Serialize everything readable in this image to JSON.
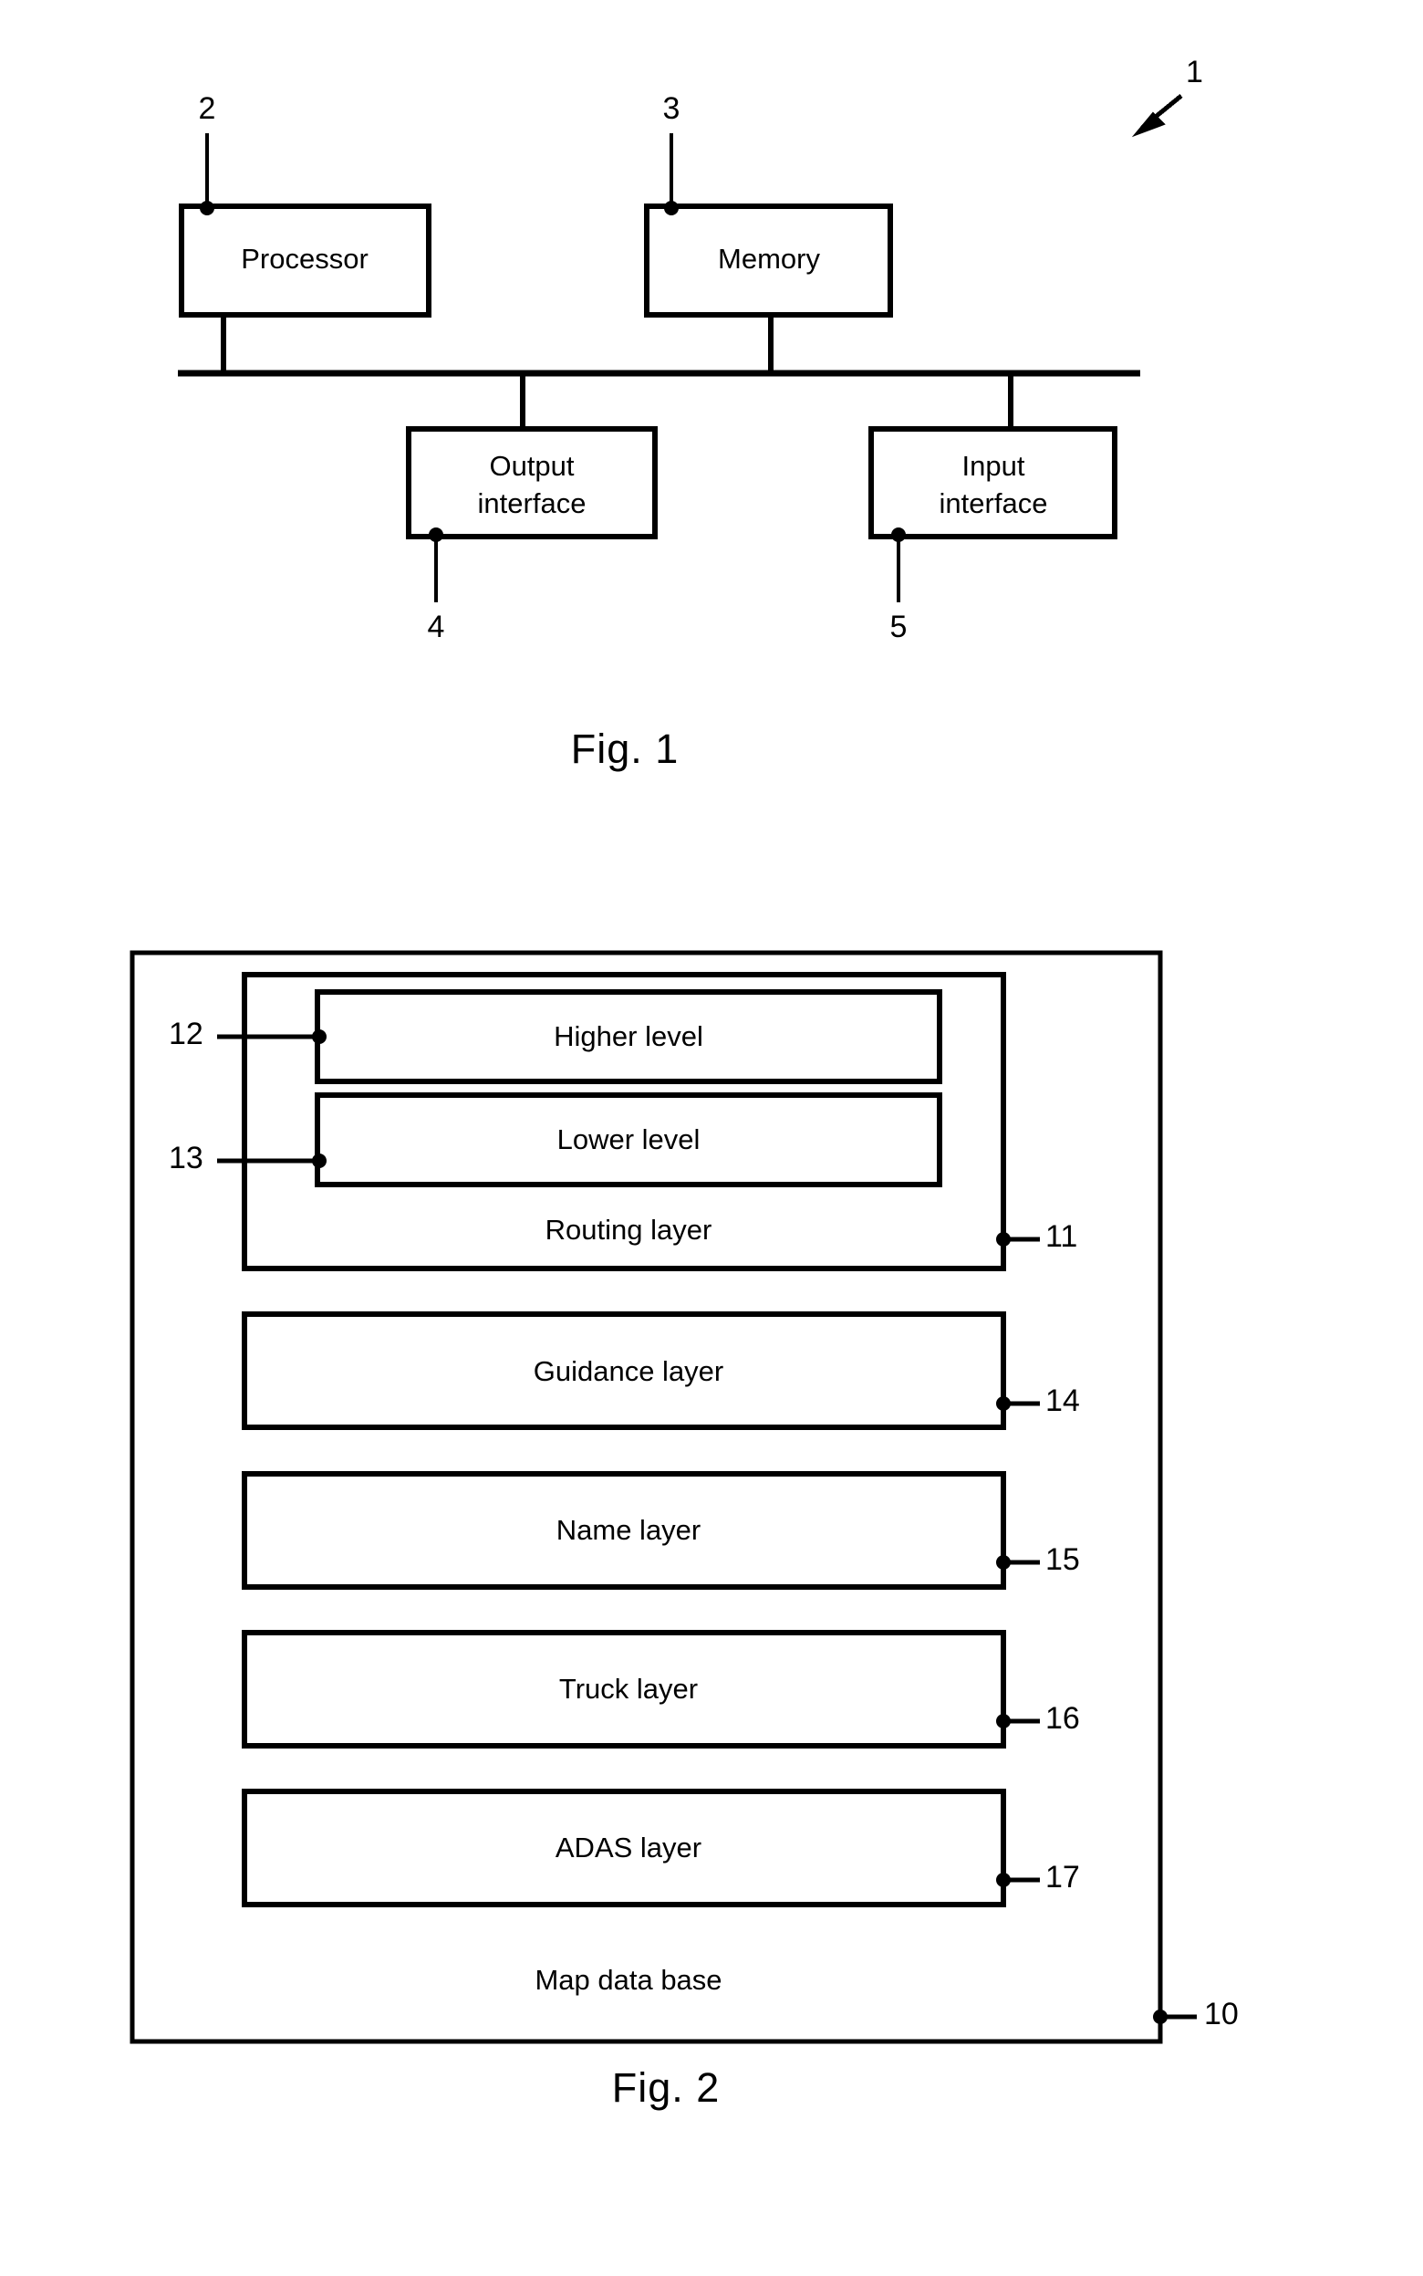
{
  "document": {
    "kind": "patent-drawing-sheet",
    "figures": [
      {
        "caption": "Fig. 1",
        "assembly_ref": "1",
        "blocks": [
          {
            "label": "Processor",
            "ref": "2"
          },
          {
            "label": "Memory",
            "ref": "3"
          },
          {
            "label": "Output\ninterface",
            "ref": "4"
          },
          {
            "label": "Input\ninterface",
            "ref": "5"
          }
        ]
      },
      {
        "caption": "Fig. 2",
        "container": {
          "label": "Map data base",
          "ref": "10"
        },
        "blocks": [
          {
            "label": "Routing layer",
            "ref": "11"
          },
          {
            "label": "Higher level",
            "ref": "12"
          },
          {
            "label": "Lower level",
            "ref": "13"
          },
          {
            "label": "Guidance layer",
            "ref": "14"
          },
          {
            "label": "Name layer",
            "ref": "15"
          },
          {
            "label": "Truck layer",
            "ref": "16"
          },
          {
            "label": "ADAS layer",
            "ref": "17"
          }
        ]
      }
    ]
  },
  "fig1": {
    "caption": "Fig. 1",
    "ref_assembly": "1",
    "processor": {
      "label": "Processor",
      "ref": "2"
    },
    "memory": {
      "label": "Memory",
      "ref": "3"
    },
    "output_interface": {
      "label_line1": "Output",
      "label_line2": "interface",
      "ref": "4"
    },
    "input_interface": {
      "label_line1": "Input",
      "label_line2": "interface",
      "ref": "5"
    }
  },
  "fig2": {
    "caption": "Fig. 2",
    "database": {
      "label": "Map data base",
      "ref": "10"
    },
    "routing_layer": {
      "label": "Routing layer",
      "ref": "11"
    },
    "higher_level": {
      "label": "Higher level",
      "ref": "12"
    },
    "lower_level": {
      "label": "Lower level",
      "ref": "13"
    },
    "guidance_layer": {
      "label": "Guidance layer",
      "ref": "14"
    },
    "name_layer": {
      "label": "Name layer",
      "ref": "15"
    },
    "truck_layer": {
      "label": "Truck layer",
      "ref": "16"
    },
    "adas_layer": {
      "label": "ADAS layer",
      "ref": "17"
    }
  },
  "style": {
    "ink": "#000000",
    "paper": "#ffffff"
  }
}
